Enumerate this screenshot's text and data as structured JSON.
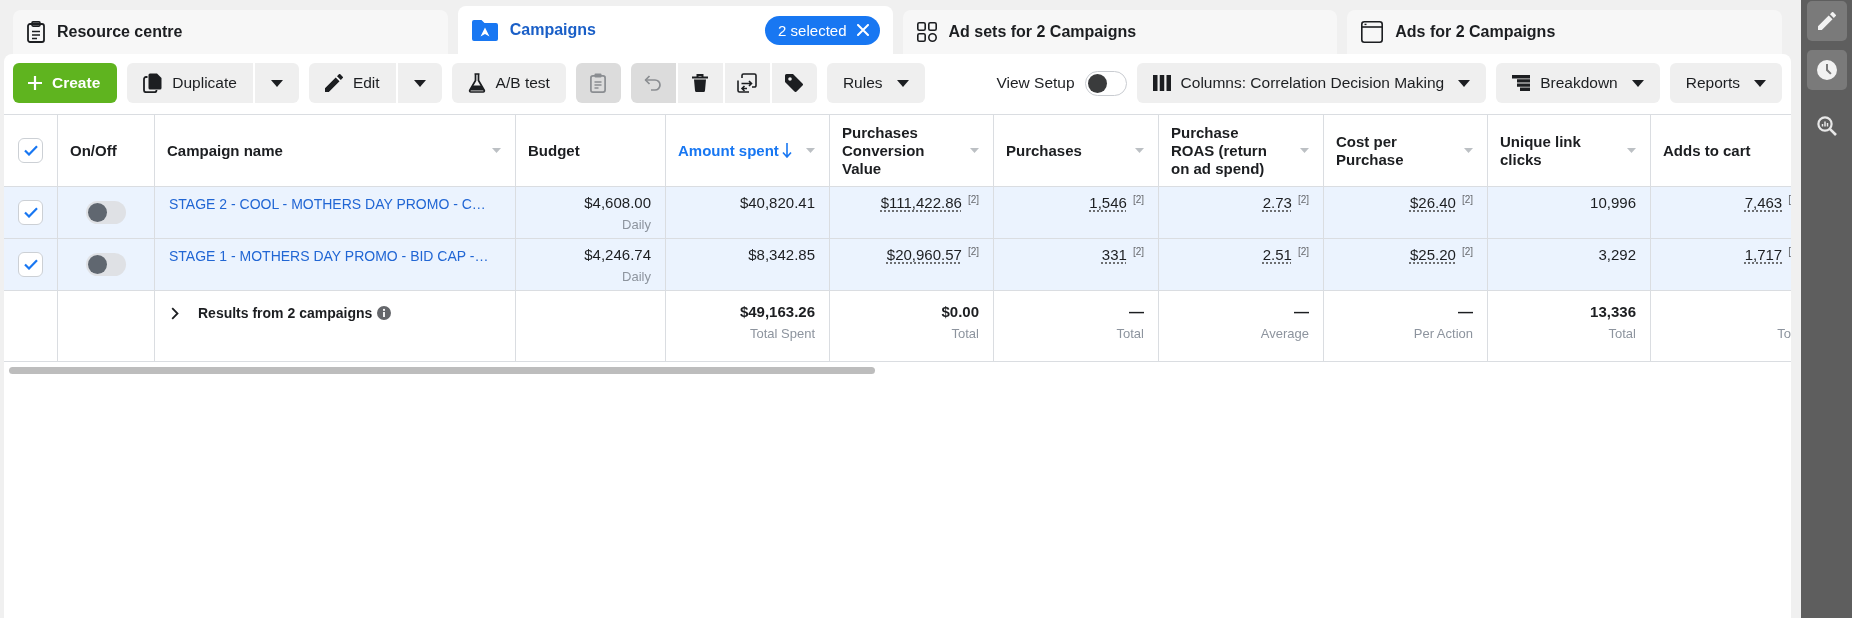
{
  "tabs": [
    {
      "kind": "resources",
      "label": "Resource centre",
      "selected": false
    },
    {
      "kind": "campaigns",
      "label": "Campaigns",
      "selected": true,
      "badge": "2 selected"
    },
    {
      "kind": "adsets",
      "label": "Ad sets for 2 Campaigns",
      "selected": false
    },
    {
      "kind": "ads",
      "label": "Ads for 2 Campaigns",
      "selected": false
    }
  ],
  "toolbar": {
    "actions": [
      {
        "kind": "create",
        "label": "Create",
        "split": false,
        "disabled": false
      },
      {
        "kind": "duplicate",
        "label": "Duplicate",
        "split": true,
        "disabled": false
      },
      {
        "kind": "edit",
        "label": "Edit",
        "split": true,
        "disabled": false
      },
      {
        "kind": "test",
        "label": "A/B test",
        "split": false,
        "disabled": false
      },
      {
        "kind": "paste",
        "split": false,
        "disabled": true
      }
    ],
    "icon_group": [
      {
        "kind": "undo",
        "disabled": true
      },
      {
        "kind": "delete",
        "disabled": false
      },
      {
        "kind": "swap",
        "disabled": false
      },
      {
        "kind": "tag",
        "disabled": false
      }
    ],
    "menus": [
      {
        "kind": "rules",
        "label": "Rules"
      }
    ],
    "view_setup": {
      "label": "View Setup",
      "on": false
    },
    "view_menus": [
      {
        "kind": "columns",
        "label": "Columns: Correlation Decision Making"
      },
      {
        "kind": "breakdown",
        "label": "Breakdown"
      },
      {
        "kind": "reports",
        "label": "Reports"
      }
    ]
  },
  "table": {
    "select_all": {
      "checked": true
    },
    "columns": [
      {
        "label": "On/Off",
        "has_menu": false,
        "sorted": false
      },
      {
        "label": "Campaign name",
        "has_menu": true,
        "sorted": false
      },
      {
        "label": "Budget",
        "has_menu": false,
        "sorted": false
      },
      {
        "label": "Amount spent",
        "has_menu": true,
        "sorted": true
      },
      {
        "label": "Purchases Conversion Value",
        "has_menu": true,
        "sorted": false
      },
      {
        "label": "Purchases",
        "has_menu": true,
        "sorted": false
      },
      {
        "label": "Purchase ROAS (return on ad spend)",
        "has_menu": true,
        "sorted": false
      },
      {
        "label": "Cost per Purchase",
        "has_menu": true,
        "sorted": false
      },
      {
        "label": "Unique link clicks",
        "has_menu": true,
        "sorted": false
      },
      {
        "label": "Adds to cart",
        "has_menu": false,
        "sorted": false
      }
    ],
    "rows": [
      {
        "selected": true,
        "on": false,
        "name": "STAGE 2 - COOL - MOTHERS DAY PROMO - C…",
        "budget": "$4,608.00",
        "budget_period": "Daily",
        "metrics": [
          {
            "value": "$40,820.41"
          },
          {
            "value": "$111,422.86",
            "note": "[2]"
          },
          {
            "value": "1,546",
            "note": "[2]"
          },
          {
            "value": "2.73",
            "note": "[2]"
          },
          {
            "value": "$26.40",
            "note": "[2]"
          },
          {
            "value": "10,996"
          },
          {
            "value": "7,463",
            "note": "["
          }
        ]
      },
      {
        "selected": true,
        "on": false,
        "name": "STAGE 1 - MOTHERS DAY PROMO - BID CAP -…",
        "budget": "$4,246.74",
        "budget_period": "Daily",
        "metrics": [
          {
            "value": "$8,342.85"
          },
          {
            "value": "$20,960.57",
            "note": "[2]"
          },
          {
            "value": "331",
            "note": "[2]"
          },
          {
            "value": "2.51",
            "note": "[2]"
          },
          {
            "value": "$25.20",
            "note": "[2]"
          },
          {
            "value": "3,292"
          },
          {
            "value": "1,717",
            "note": "["
          }
        ]
      }
    ],
    "totals": {
      "expanded": false,
      "label": "Results from 2 campaigns",
      "metrics": [
        {
          "value": "$49,163.26",
          "caption": "Total Spent"
        },
        {
          "value": "$0.00",
          "caption": "Total"
        },
        {
          "value": "—",
          "caption": "Total"
        },
        {
          "value": "—",
          "caption": "Average"
        },
        {
          "value": "—",
          "caption": "Per Action"
        },
        {
          "value": "13,336",
          "caption": "Total"
        },
        {
          "caption": "To"
        }
      ]
    }
  }
}
